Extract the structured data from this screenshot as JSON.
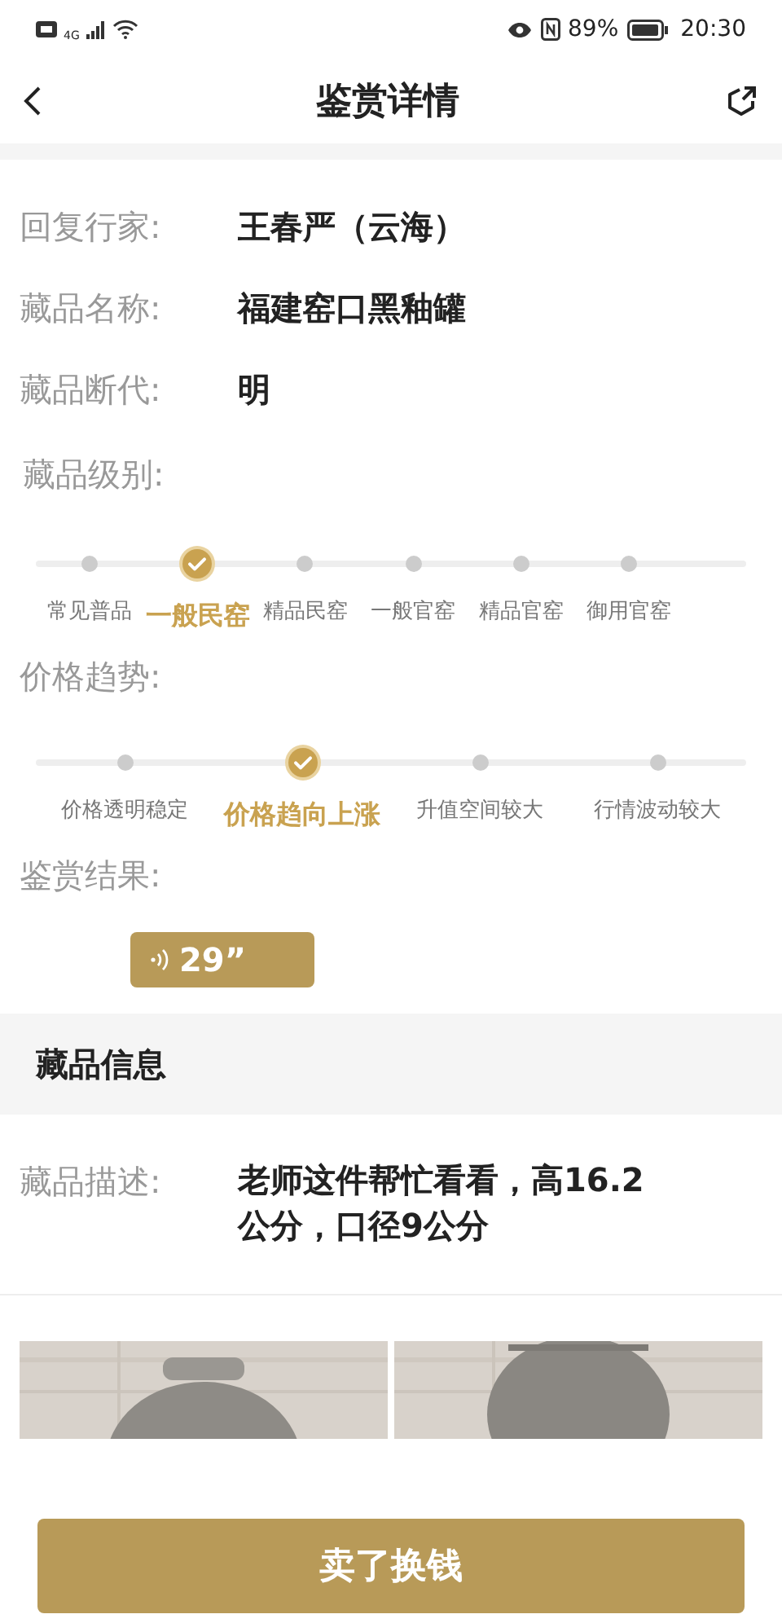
{
  "status_bar": {
    "network": "4G",
    "battery": "89%",
    "time": "20:30"
  },
  "header": {
    "title": "鉴赏详情"
  },
  "fields": [
    {
      "label": "回复行家:",
      "value": "王春严（云海）"
    },
    {
      "label": "藏品名称:",
      "value": "福建窑口黑釉罐"
    },
    {
      "label": "藏品断代:",
      "value": "明"
    }
  ],
  "grade": {
    "label": "藏品级别:",
    "stops": [
      {
        "label": "常见普品",
        "selected": false
      },
      {
        "label": "一般民窑",
        "selected": true
      },
      {
        "label": "精品民窑",
        "selected": false
      },
      {
        "label": "一般官窑",
        "selected": false
      },
      {
        "label": "精品官窑",
        "selected": false
      },
      {
        "label": "御用官窑",
        "selected": false
      }
    ]
  },
  "trend": {
    "label": "价格趋势:",
    "stops": [
      {
        "label": "价格透明稳定",
        "selected": false
      },
      {
        "label": "价格趋向上涨",
        "selected": true
      },
      {
        "label": "升值空间较大",
        "selected": false
      },
      {
        "label": "行情波动较大",
        "selected": false
      }
    ]
  },
  "result": {
    "label": "鉴赏结果:",
    "voice_duration": "29”"
  },
  "info_section": {
    "title": "藏品信息",
    "description_label": "藏品描述:",
    "description": "老师这件帮忙看看，高16.2公分，口径9公分"
  },
  "action_button": "卖了换钱"
}
